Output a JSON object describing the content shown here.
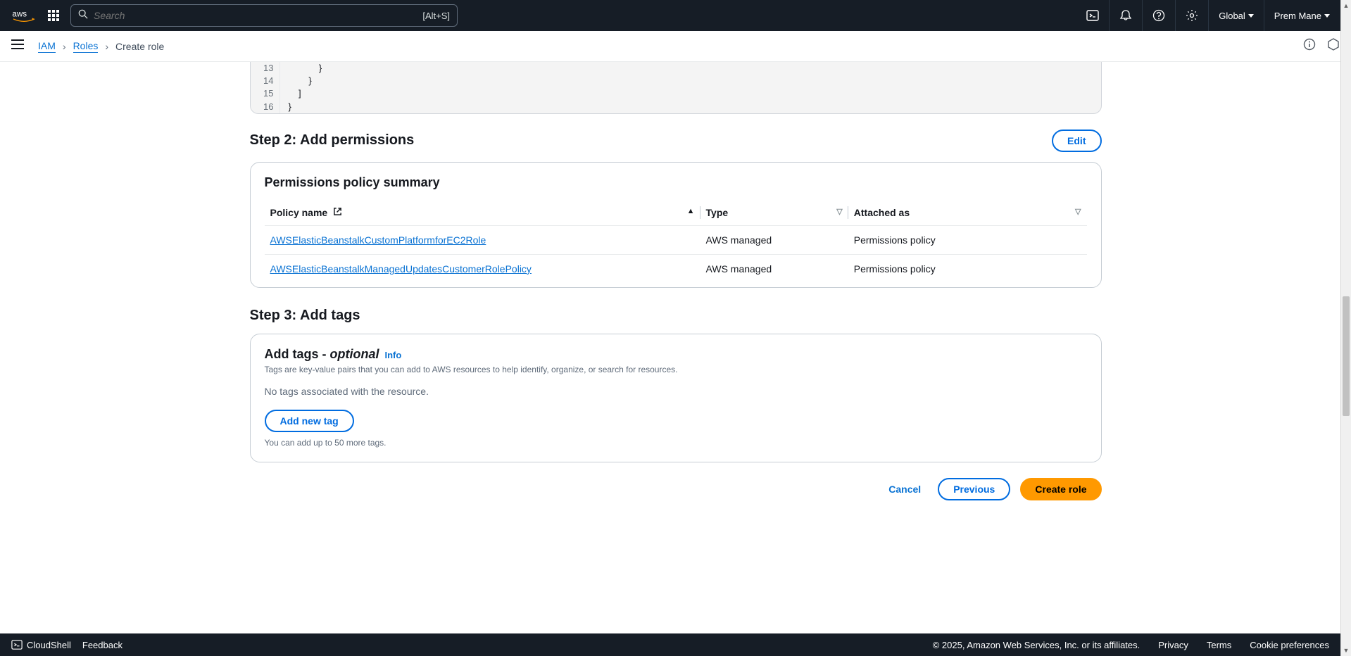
{
  "header": {
    "search_placeholder": "Search",
    "search_shortcut": "[Alt+S]",
    "region": "Global",
    "user": "Prem Mane"
  },
  "breadcrumbs": {
    "items": [
      "IAM",
      "Roles",
      "Create role"
    ]
  },
  "code": {
    "lines": [
      {
        "num": "13",
        "txt": "            }"
      },
      {
        "num": "14",
        "txt": "        }"
      },
      {
        "num": "15",
        "txt": "    ]"
      },
      {
        "num": "16",
        "txt": "}"
      }
    ]
  },
  "step2": {
    "title": "Step 2: Add permissions",
    "edit": "Edit",
    "panel_title": "Permissions policy summary",
    "columns": {
      "policy": "Policy name",
      "type": "Type",
      "attached": "Attached as"
    },
    "rows": [
      {
        "name": "AWSElasticBeanstalkCustomPlatformforEC2Role",
        "type": "AWS managed",
        "attached": "Permissions policy"
      },
      {
        "name": "AWSElasticBeanstalkManagedUpdatesCustomerRolePolicy",
        "type": "AWS managed",
        "attached": "Permissions policy"
      }
    ]
  },
  "step3": {
    "title": "Step 3: Add tags",
    "tags_title": "Add tags - ",
    "optional": "optional",
    "info": "Info",
    "desc": "Tags are key-value pairs that you can add to AWS resources to help identify, organize, or search for resources.",
    "empty": "No tags associated with the resource.",
    "add_btn": "Add new tag",
    "hint": "You can add up to 50 more tags."
  },
  "actions": {
    "cancel": "Cancel",
    "previous": "Previous",
    "create": "Create role"
  },
  "footer": {
    "cloudshell": "CloudShell",
    "feedback": "Feedback",
    "copyright": "© 2025, Amazon Web Services, Inc. or its affiliates.",
    "privacy": "Privacy",
    "terms": "Terms",
    "cookies": "Cookie preferences"
  }
}
